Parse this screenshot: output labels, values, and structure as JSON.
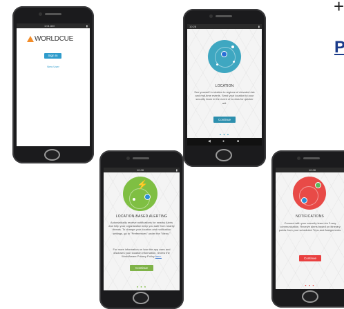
{
  "colors": {
    "location": "#3fa7c1",
    "alerting": "#7fbf43",
    "notifications": "#e84a47",
    "button_blue": "#2f9ccc",
    "button_teal": "#2c8fae",
    "button_green": "#7fb348",
    "button_red": "#e94040",
    "link": "#1a3a8a"
  },
  "partial_text": {
    "plus": "+",
    "letter": "P"
  },
  "phone_signin": {
    "status_time": "1:01 AM",
    "brand": "WORLDCUE",
    "sign_in_label": "Sign In",
    "new_user_label": "New User"
  },
  "phone_location": {
    "status_time": "10:28",
    "title": "LOCATION",
    "description": "See yourself in relation to regions of elevated risk and real-time events. Send your location to your security team in the event of a crisis for quicker aid.",
    "button_label": "Continue",
    "pager": "● ● ●"
  },
  "phone_alerting": {
    "status_time": "10:28",
    "title": "LOCATION-BASED ALERTING",
    "description": "Automatically receive notifications for nearby Alerts and help your organization keep you safe from nearby threats. To change your location and notification settings, go to \"Preferences\" under the \"Menu.\"",
    "info_text": "For more information on how the app uses and discloses your location information, review the WorldAware Privacy Policy",
    "info_link": "here.",
    "button_label": "Continue",
    "pager": "● ● ●"
  },
  "phone_notifications": {
    "status_time": "10:28",
    "title": "NOTIFICATIONS",
    "description": "Connect with your security team via 2-way communication. Receive alerts based on itinerary points from your scheduled Trips and Assignments.",
    "button_label": "Continue",
    "pager": "● ● ●"
  }
}
